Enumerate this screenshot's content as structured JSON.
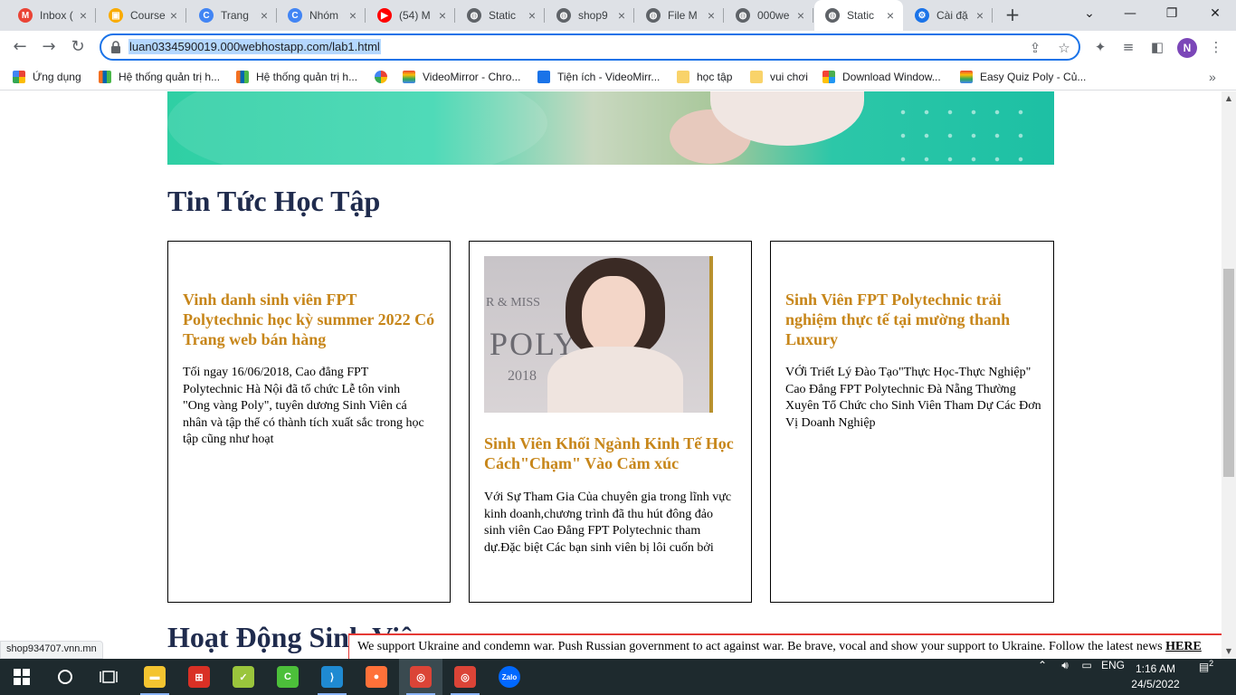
{
  "browser": {
    "tabs": [
      {
        "title": "Inbox (",
        "icon": "gmail-icon",
        "color": "#ea4335",
        "glyph": "M"
      },
      {
        "title": "Course",
        "icon": "classroom-icon",
        "color": "#f9ab00",
        "glyph": "▣"
      },
      {
        "title": "Trang",
        "icon": "chrome-app-icon",
        "color": "#4285f4",
        "glyph": "C"
      },
      {
        "title": "Nhóm",
        "icon": "chrome-app-icon",
        "color": "#4285f4",
        "glyph": "C"
      },
      {
        "title": "(54) M",
        "icon": "youtube-icon",
        "color": "#ff0000",
        "glyph": "▶"
      },
      {
        "title": "Static",
        "icon": "globe-icon",
        "color": "#5f6368",
        "glyph": "◍"
      },
      {
        "title": "shop9",
        "icon": "globe-icon",
        "color": "#5f6368",
        "glyph": "◍"
      },
      {
        "title": "File M",
        "icon": "globe-icon",
        "color": "#5f6368",
        "glyph": "◍"
      },
      {
        "title": "000we",
        "icon": "globe-icon",
        "color": "#5f6368",
        "glyph": "◍"
      },
      {
        "title": "Static",
        "icon": "globe-icon",
        "color": "#5f6368",
        "glyph": "◍",
        "active": true
      },
      {
        "title": "Cài đặ",
        "icon": "settings-icon",
        "color": "#1a73e8",
        "glyph": "⚙"
      }
    ],
    "url": "luan0334590019.000webhostapp.com/lab1.html",
    "profile_initial": "N",
    "bookmarks": [
      {
        "label": "Ứng dụng",
        "icon": "apps-grid-icon"
      },
      {
        "label": "Hệ thống quản trị h...",
        "icon": "fpt-icon"
      },
      {
        "label": "Hệ thống quản trị h...",
        "icon": "fpt-icon"
      },
      {
        "label": "",
        "icon": "google-icon"
      },
      {
        "label": "VideoMirror - Chro...",
        "icon": "rainbow-icon"
      },
      {
        "label": "Tiện ích - VideoMirr...",
        "icon": "puzzle-icon"
      },
      {
        "label": "học tập",
        "icon": "folder-icon"
      },
      {
        "label": "vui chơi",
        "icon": "folder-icon"
      },
      {
        "label": "Download Window...",
        "icon": "windows-icon"
      },
      {
        "label": "Easy Quiz Poly - Củ...",
        "icon": "rainbow-icon"
      }
    ]
  },
  "page": {
    "section_title": "Tin Tức Học Tập",
    "cards": [
      {
        "title": "Vinh danh sinh viên FPT Polytechnic học kỳ summer 2022 Có Trang web bán hàng",
        "text": "Tối ngay 16/06/2018, Cao đẳng FPT Polytechnic Hà Nội đã tổ chức Lễ tôn vinh \"Ong vàng Poly\", tuyên dương Sinh Viên cá nhân và tập thể có thành tích xuất sắc trong học tập cũng như hoạt"
      },
      {
        "title": "Sinh Viên Khối Ngành Kinh Tế Học Cách\"Chạm\" Vào Cảm xúc",
        "text": "Với Sự Tham Gia Của chuyên gia trong lĩnh vực kinh doanh,chương trình đã thu hút đông đảo sinh viên Cao Đẳng FPT Polytechnic tham dự.Đặc biệt Các bạn sinh viên bị lôi cuốn bởi",
        "photo_text": "R & MISS",
        "photo_text2": "POLY",
        "photo_year": "2018"
      },
      {
        "title": "Sinh Viên FPT Polytechnic trải nghiệm thực tế tại mường thanh Luxury",
        "text": "VỚi Triết Lý Đào Tạo\"Thực Học-Thực Nghiệp\" Cao Đẳng FPT Polytechnic Đà Nẵng Thường Xuyên Tổ Chức cho Sinh Viên Tham Dự Các Đơn Vị Doanh Nghiệp"
      }
    ],
    "next_section_title": "Hoạt Động Sinh Viê"
  },
  "ukraine_banner": {
    "text": "We support Ukraine and condemn war. Push Russian government to act against war. Be brave, vocal and show your support to Ukraine. Follow the latest news ",
    "link": "HERE"
  },
  "status_url": "shop934707.vnn.mn",
  "taskbar": {
    "apps": [
      {
        "name": "file-explorer-icon",
        "color": "#f4c430",
        "glyph": "▬"
      },
      {
        "name": "app-icon-2",
        "color": "#d93025",
        "glyph": "⊞"
      },
      {
        "name": "app-icon-3",
        "color": "#9ac53c",
        "glyph": "✓"
      },
      {
        "name": "app-icon-4",
        "color": "#4cbf3a",
        "glyph": "C"
      },
      {
        "name": "vscode-icon",
        "color": "#1f8ad2",
        "glyph": "⟩"
      },
      {
        "name": "firefox-icon",
        "color": "#ff7139",
        "glyph": "●"
      },
      {
        "name": "chrome-profile-icon",
        "color": "#db4437",
        "glyph": "◎"
      },
      {
        "name": "chrome-icon",
        "color": "#db4437",
        "glyph": "◎"
      },
      {
        "name": "zalo-icon",
        "color": "#0068ff",
        "glyph": "Zalo"
      }
    ],
    "language": "ENG",
    "time": "1:16 AM",
    "date": "24/5/2022",
    "notification_count": "2"
  },
  "colors": {
    "title_navy": "#1f2b4d",
    "card_title_gold": "#c7861a",
    "omnibox_focus": "#1a73e8",
    "ukraine_red": "#e53935"
  }
}
